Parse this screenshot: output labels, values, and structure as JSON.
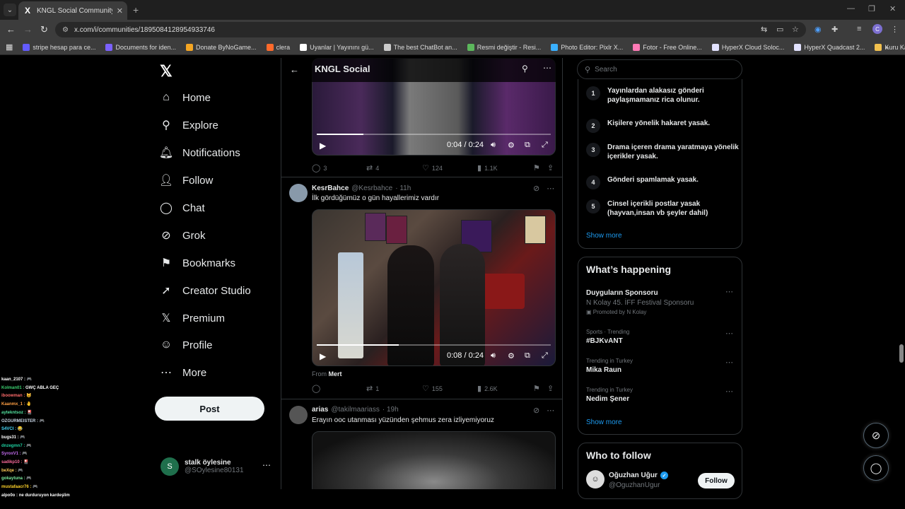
{
  "browser": {
    "tab_title": "KNGL Social Community / X",
    "url": "x.com/i/communities/1895084128954933746",
    "bookmarks": [
      {
        "label": "stripe hesap para ce...",
        "color": "#635bff"
      },
      {
        "label": "Documents for iden...",
        "color": "#7b61ff"
      },
      {
        "label": "Donate ByNoGame...",
        "color": "#f5a623"
      },
      {
        "label": "clera",
        "color": "#ff6a2b"
      },
      {
        "label": "Uyanlar | Yayınını gü...",
        "color": "#ffffff"
      },
      {
        "label": "The best ChatBot an...",
        "color": "#cccccc"
      },
      {
        "label": "Resmi değiştir - Resi...",
        "color": "#5cb85c"
      },
      {
        "label": "Photo Editor: Pixlr X...",
        "color": "#3ab0ff"
      },
      {
        "label": "Fotor - Free Online...",
        "color": "#ff7ab6"
      },
      {
        "label": "HyperX Cloud Soloc...",
        "color": "#e2e2ff"
      },
      {
        "label": "HyperX Quadcast 2...",
        "color": "#e2e2ff"
      },
      {
        "label": "Kuru Kafa Emojis |...",
        "color": "#f2c14e"
      }
    ]
  },
  "nav": {
    "items": [
      {
        "label": "Home",
        "icon": "home-icon",
        "glyph": "⌂"
      },
      {
        "label": "Explore",
        "icon": "search-icon",
        "glyph": "⚲"
      },
      {
        "label": "Notifications",
        "icon": "bell-icon",
        "glyph": "🔔︎"
      },
      {
        "label": "Follow",
        "icon": "person-add-icon",
        "glyph": "👤︎"
      },
      {
        "label": "Chat",
        "icon": "chat-bubble-icon",
        "glyph": "◯"
      },
      {
        "label": "Grok",
        "icon": "grok-icon",
        "glyph": "⊘"
      },
      {
        "label": "Bookmarks",
        "icon": "bookmark-icon",
        "glyph": "⚑"
      },
      {
        "label": "Creator Studio",
        "icon": "rocket-icon",
        "glyph": "➚"
      },
      {
        "label": "Premium",
        "icon": "x-logo-icon",
        "glyph": "𝕏"
      },
      {
        "label": "Profile",
        "icon": "profile-icon",
        "glyph": "☺"
      },
      {
        "label": "More",
        "icon": "more-circle-icon",
        "glyph": "⋯"
      }
    ],
    "post_label": "Post",
    "account": {
      "initial": "S",
      "name": "stalk öylesine",
      "handle": "@SOylesine80131"
    }
  },
  "community": {
    "title": "KNGL Social"
  },
  "tweets": [
    {
      "video": {
        "time": "0:04 / 0:24",
        "progress": 0.2
      },
      "replies": "3",
      "reposts": "4",
      "likes": "124",
      "views": "1.1K"
    },
    {
      "name": "KesrBahce",
      "handle": "@Kesrbahce",
      "time": "· 11h",
      "text": "İlk gördüğümüz o gün hayallerimiz vardır",
      "avatar_color": "#8899aa",
      "video": {
        "time": "0:08 / 0:24",
        "progress": 0.35
      },
      "from_prefix": "From",
      "from_name": "Mert",
      "replies": "",
      "reposts": "1",
      "likes": "155",
      "views": "2.6K"
    },
    {
      "name": "arias",
      "handle": "@takilmaariass",
      "time": "· 19h",
      "text": "Erayın ooc utanması yüzünden şehmus zera izliyemiyoruz",
      "avatar_color": "#555"
    }
  ],
  "sidebar": {
    "search_placeholder": "Search",
    "rules": [
      {
        "num": "1",
        "text": "Yayınlardan alakasız gönderi paylaşmamanız rica olunur."
      },
      {
        "num": "2",
        "text": "Kişilere yönelik hakaret yasak."
      },
      {
        "num": "3",
        "text": "Drama içeren drama yaratmaya yönelik içerikler yasak."
      },
      {
        "num": "4",
        "text": "Gönderi spamlamak yasak."
      },
      {
        "num": "5",
        "text": "Cinsel içerikli postlar yasak (hayvan,insan vb şeyler dahil)"
      }
    ],
    "rules_show_more": "Show more",
    "happening_title": "What’s happening",
    "trends": [
      {
        "context": "",
        "name": "Duyguların Sponsoru",
        "sub": "N Kolay 45. İFF Festival Sponsoru",
        "promo": "Promoted by N Kolay"
      },
      {
        "context": "Sports · Trending",
        "name": "#BJKvANT",
        "sub": "",
        "promo": ""
      },
      {
        "context": "Trending in Turkey",
        "name": "Mika Raun",
        "sub": "",
        "promo": ""
      },
      {
        "context": "Trending in Turkey",
        "name": "Nedim Şener",
        "sub": "",
        "promo": ""
      }
    ],
    "happening_show_more": "Show more",
    "who_title": "Who to follow",
    "who": {
      "name": "Oğuzhan Uğur",
      "handle": "@OguzhanUgur",
      "follow_label": "Follow"
    }
  },
  "chat_overlay": [
    {
      "user": "kaan_2107 :",
      "text": "🎮",
      "color": "#ffffff"
    },
    {
      "user": "Kolman01 :",
      "text": "GWÇ ABLA GEÇ",
      "color": "#3cd070"
    },
    {
      "user": "iboowman :",
      "text": "😺",
      "color": "#ff6b6b"
    },
    {
      "user": "Kaanmx_1 :",
      "text": "🤚",
      "color": "#ff9f43"
    },
    {
      "user": "aytekntsoz :",
      "text": "🎴",
      "color": "#54e3a0"
    },
    {
      "user": "OZGURMEISTER :",
      "text": "🎮",
      "color": "#c8d6e5"
    },
    {
      "user": "S4VCI :",
      "text": "😂",
      "color": "#48dbfb"
    },
    {
      "user": "bugs31 :",
      "text": "🎮",
      "color": "#ffffff"
    },
    {
      "user": "dnzegmn7 :",
      "text": "🎮",
      "color": "#1dd1a1"
    },
    {
      "user": "SyroxV1 :",
      "text": "🎮",
      "color": "#c56cf0"
    },
    {
      "user": "sadikp10 :",
      "text": "🎴",
      "color": "#ff6b9d"
    },
    {
      "user": "beXqe :",
      "text": "🎮",
      "color": "#feca57"
    },
    {
      "user": "gokaytuna :",
      "text": "🎮",
      "color": "#7bed9f"
    },
    {
      "user": "mustafaacr76 :",
      "text": "🎮",
      "color": "#ffd32a"
    },
    {
      "user": "alpo0o :",
      "text": "ne durduruyon kardeşlim",
      "color": "#ffffff"
    }
  ]
}
